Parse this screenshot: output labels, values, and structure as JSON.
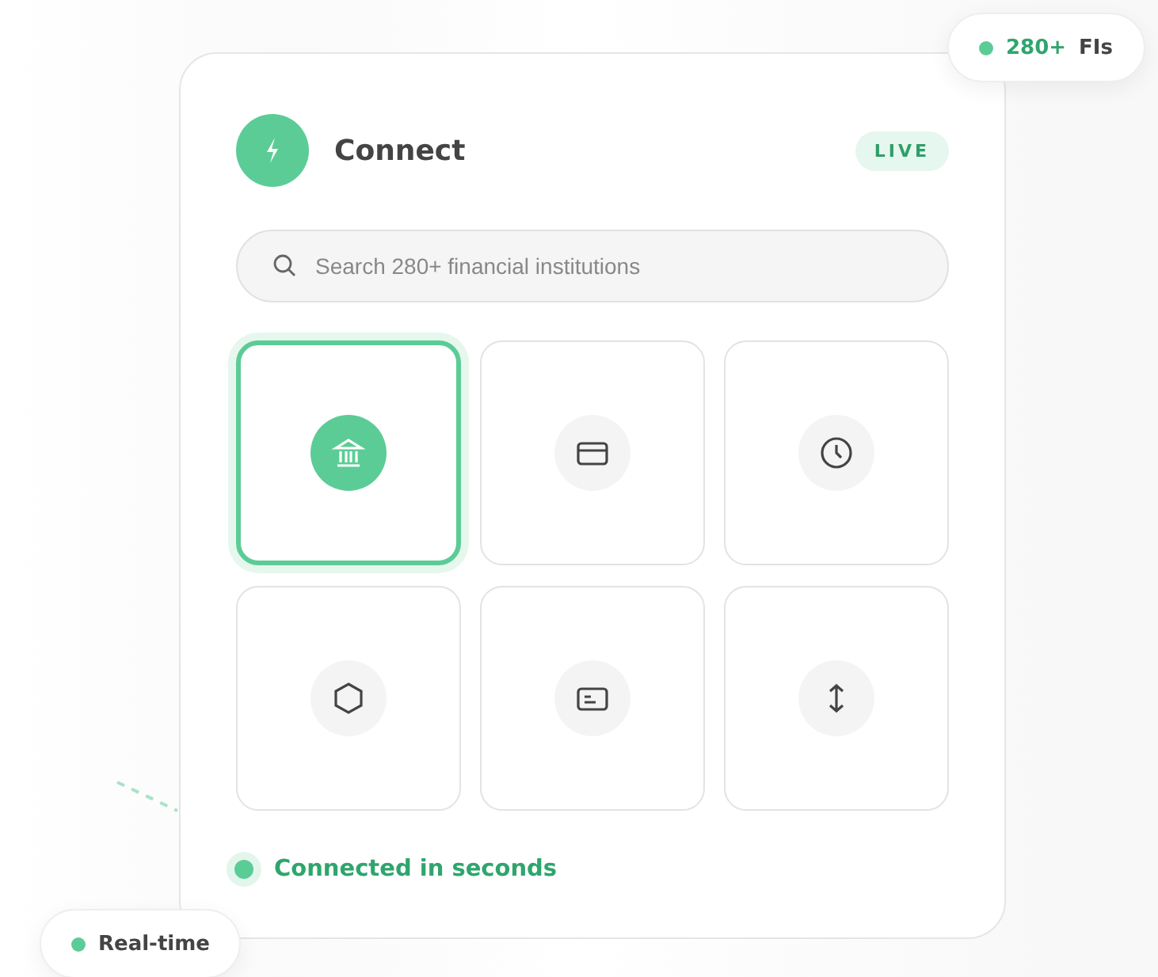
{
  "card": {
    "title": "Connect",
    "status_badge": "LIVE",
    "search": {
      "placeholder": "Search 280+ financial institutions"
    },
    "tiles": [
      {
        "kind": "bank",
        "selected": true
      },
      {
        "kind": "card",
        "selected": false
      },
      {
        "kind": "clock",
        "selected": false
      },
      {
        "kind": "hexagon",
        "selected": false
      },
      {
        "kind": "id",
        "selected": false
      },
      {
        "kind": "transfer",
        "selected": false
      }
    ],
    "footer": "Connected in seconds"
  },
  "floating_badges": [
    {
      "kind": "top",
      "count": "280+",
      "label": "FIs"
    },
    {
      "kind": "bottom",
      "label": "Real-time"
    }
  ]
}
